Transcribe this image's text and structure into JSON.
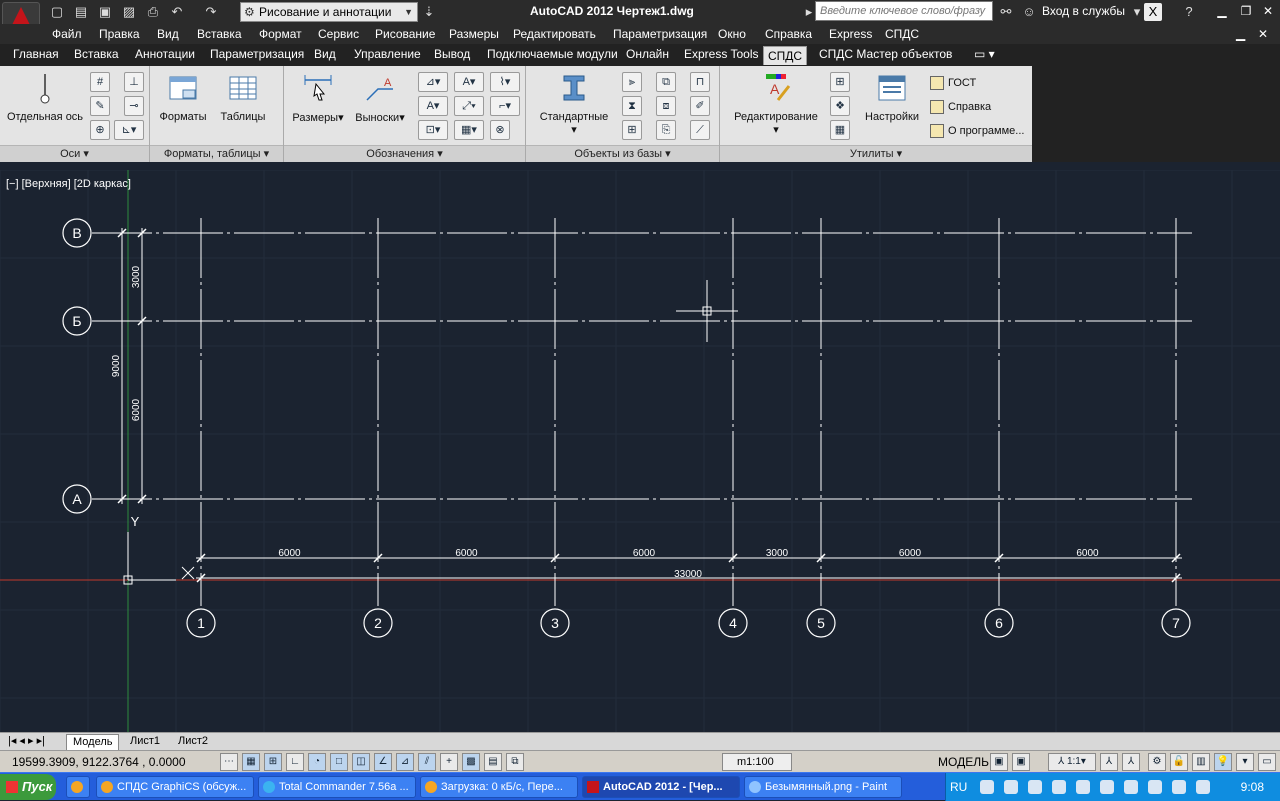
{
  "title_bar": {
    "app_title": "AutoCAD 2012   Чертеж1.dwg",
    "workspace": "Рисование и аннотации",
    "search_placeholder": "Введите ключевое слово/фразу",
    "sign_in": "Вход в службы"
  },
  "menu": [
    "Файл",
    "Правка",
    "Вид",
    "Вставка",
    "Формат",
    "Сервис",
    "Рисование",
    "Размеры",
    "Редактировать",
    "Параметризация",
    "Окно",
    "Справка",
    "Express",
    "СПДС"
  ],
  "ribbon_tabs": [
    "Главная",
    "Вставка",
    "Аннотации",
    "Параметризация",
    "Вид",
    "Управление",
    "Вывод",
    "Подключаемые модули",
    "Онлайн",
    "Express Tools",
    "СПДС",
    "СПДС Мастер объектов"
  ],
  "ribbon_active_tab": "СПДС",
  "panels": {
    "axes": {
      "label": "Оси",
      "btn": "Отдельная ось"
    },
    "formats": {
      "label": "Форматы, таблицы",
      "btn1": "Форматы",
      "btn2": "Таблицы"
    },
    "designations": {
      "label": "Обозначения",
      "btn1": "Размеры",
      "btn2": "Выноски"
    },
    "db_objects": {
      "label": "Объекты из базы",
      "btn": "Стандартные"
    },
    "utilities": {
      "label": "Утилиты",
      "btn1": "Редактирование",
      "btn2": "Настройки",
      "links": [
        "ГОСТ",
        "Справка",
        "О программе..."
      ]
    }
  },
  "viewport_label": "[−] [Верхняя] [2D каркас]",
  "drawing": {
    "row_axes": [
      "В",
      "Б",
      "А"
    ],
    "col_axes": [
      "1",
      "2",
      "3",
      "4",
      "5",
      "6",
      "7"
    ],
    "col_spans": [
      "6000",
      "6000",
      "6000",
      "3000",
      "6000",
      "6000"
    ],
    "total_span": "33000",
    "row_spans": [
      "3000",
      "6000"
    ],
    "row_total": "9000",
    "ucs_y": "Y"
  },
  "layout_tabs": [
    "Модель",
    "Лист1",
    "Лист2"
  ],
  "status": {
    "coords": "19599.3909, 9122.3764 , 0.0000",
    "scale": "m1:100",
    "space": "МОДЕЛЬ",
    "annot_scale": "1:1"
  },
  "taskbar": {
    "start": "Пуск",
    "items": [
      "СПДС GraphiCS (обсуж...",
      "Total Commander 7.56a ...",
      "Загрузка: 0 кБ/с, Пере...",
      "AutoCAD 2012 - [Чер...",
      "Безымянный.png - Paint"
    ],
    "lang": "RU",
    "clock": "9:08"
  },
  "colors": {
    "canvas": "#1b2330",
    "grid": "#232d3b",
    "ucs_x": "#c0392b",
    "ucs_y": "#2e8b3e"
  }
}
